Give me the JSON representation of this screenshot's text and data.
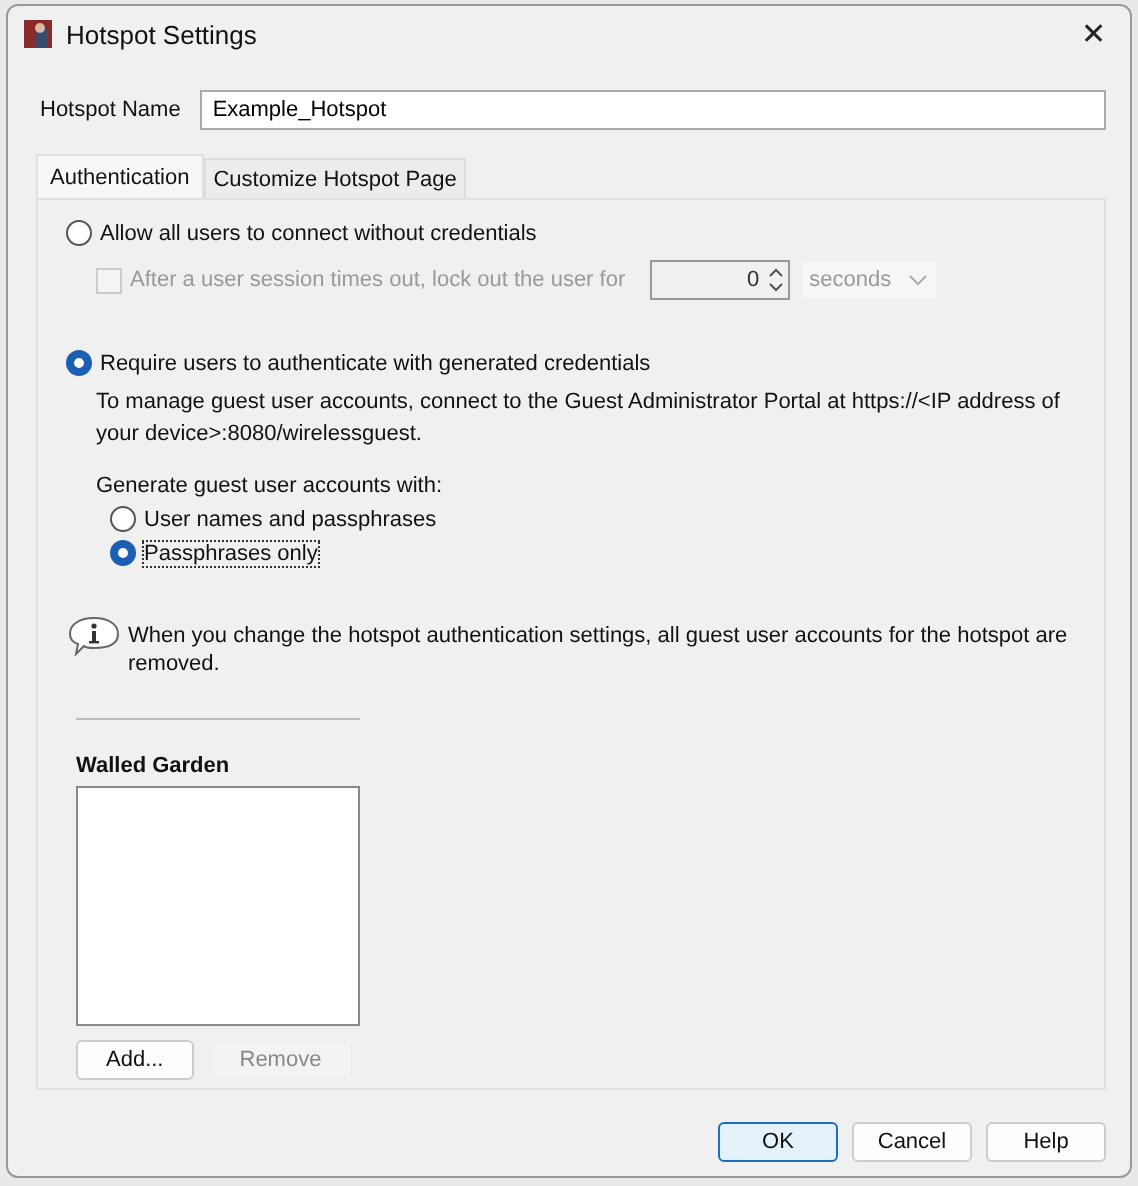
{
  "window": {
    "title": "Hotspot Settings",
    "close": "✕"
  },
  "hotspot_name": {
    "label": "Hotspot Name",
    "value": "Example_Hotspot"
  },
  "tabs": [
    {
      "label": "Authentication",
      "selected": true
    },
    {
      "label": "Customize Hotspot Page",
      "selected": false
    }
  ],
  "auth_options": [
    {
      "label": "Allow all users to connect without credentials",
      "selected": false
    },
    {
      "label": "Require users to authenticate with generated credentials",
      "selected": true
    }
  ],
  "lockout": {
    "label": "After a user session times out, lock out the user for",
    "checked": false,
    "disabled": true,
    "value": "0",
    "unit": "seconds"
  },
  "portal_note": "To manage guest user accounts, connect to the Guest Administrator Portal at https://<IP address of your device>:8080/wirelessguest.",
  "generate_label": "Generate guest user accounts with:",
  "generate_options": [
    {
      "label": "User names and passphrases",
      "selected": false
    },
    {
      "label": "Passphrases only",
      "selected": true
    }
  ],
  "info": "When you change the hotspot authentication settings, all guest user accounts for the hotspot are removed.",
  "walled_garden": {
    "title": "Walled Garden",
    "buttons": [
      {
        "label": "Add...",
        "disabled": false
      },
      {
        "label": "Remove",
        "disabled": true
      }
    ]
  },
  "buttons": [
    {
      "label": "OK",
      "default": true
    },
    {
      "label": "Cancel",
      "default": false
    },
    {
      "label": "Help",
      "default": false
    }
  ]
}
